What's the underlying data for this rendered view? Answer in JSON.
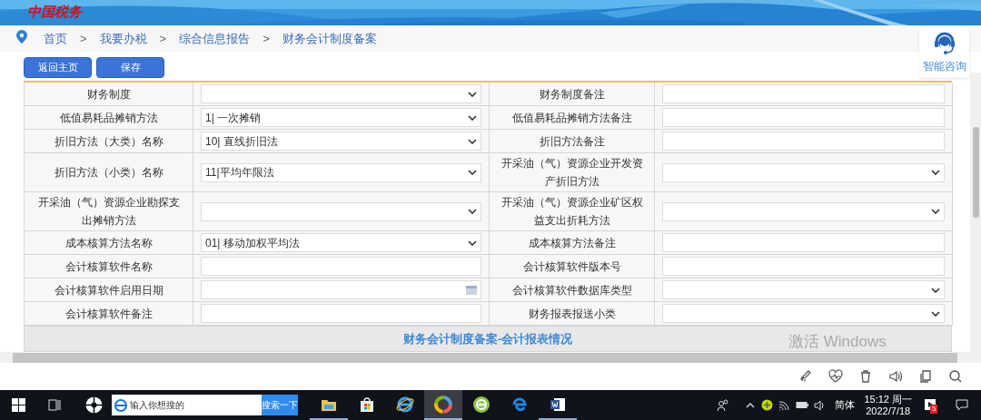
{
  "header": {
    "logo_text": "中国税务"
  },
  "breadcrumb": {
    "separator": ">",
    "items": [
      "首页",
      "我要办税",
      "综合信息报告",
      "财务会计制度备案"
    ]
  },
  "buttons": [
    "返回主页",
    "保存"
  ],
  "assistant": {
    "label": "智能咨询"
  },
  "form": {
    "rows": [
      {
        "left": {
          "label": "财务制度",
          "kind": "select"
        },
        "right": {
          "label": "财务制度备注",
          "kind": "text"
        }
      },
      {
        "left": {
          "label": "低值易耗品摊销方法",
          "kind": "select",
          "value": "1| 一次摊销"
        },
        "right": {
          "label": "低值易耗品摊销方法备注",
          "kind": "text"
        }
      },
      {
        "left": {
          "label": "折旧方法（大类）名称",
          "kind": "select",
          "value": "10| 直线折旧法"
        },
        "right": {
          "label": "折旧方法备注",
          "kind": "text"
        }
      },
      {
        "left": {
          "label": "折旧方法（小类）名称",
          "kind": "select",
          "value": "11|平均年限法"
        },
        "right": {
          "label": "开采油（气）资源企业开发资产折旧方法",
          "kind": "select"
        }
      },
      {
        "left": {
          "label": "开采油（气）资源企业勘探支出摊销方法",
          "kind": "select"
        },
        "right": {
          "label": "开采油（气）资源企业矿区权益支出折耗方法",
          "kind": "select"
        }
      },
      {
        "left": {
          "label": "成本核算方法名称",
          "kind": "select",
          "value": "01| 移动加权平均法"
        },
        "right": {
          "label": "成本核算方法备注",
          "kind": "text"
        }
      },
      {
        "left": {
          "label": "会计核算软件名称",
          "kind": "text"
        },
        "right": {
          "label": "会计核算软件版本号",
          "kind": "text"
        }
      },
      {
        "left": {
          "label": "会计核算软件启用日期",
          "kind": "date"
        },
        "right": {
          "label": "会计核算软件数据库类型",
          "kind": "select"
        }
      },
      {
        "left": {
          "label": "会计核算软件备注",
          "kind": "text"
        },
        "right": {
          "label": "财务报表报送小类",
          "kind": "select"
        }
      }
    ],
    "section_title": "财务会计制度备案-会计报表情况"
  },
  "activation_notice": "激活 Windows",
  "taskbar": {
    "search_placeholder": "输入你想搜的",
    "search_button": "搜索一下",
    "apps": [
      {
        "kind": "explorer",
        "running": true,
        "selected": false
      },
      {
        "kind": "store",
        "running": false,
        "selected": false
      },
      {
        "kind": "ie",
        "running": false,
        "selected": false
      },
      {
        "kind": "ring",
        "running": true,
        "selected": true
      },
      {
        "kind": "green",
        "running": false,
        "selected": false
      },
      {
        "kind": "edge",
        "running": false,
        "selected": false
      },
      {
        "kind": "word",
        "running": true,
        "selected": false
      }
    ],
    "ime": "简体",
    "time": "15:12 周一",
    "date": "2022/7/18",
    "notification_count": "5"
  }
}
